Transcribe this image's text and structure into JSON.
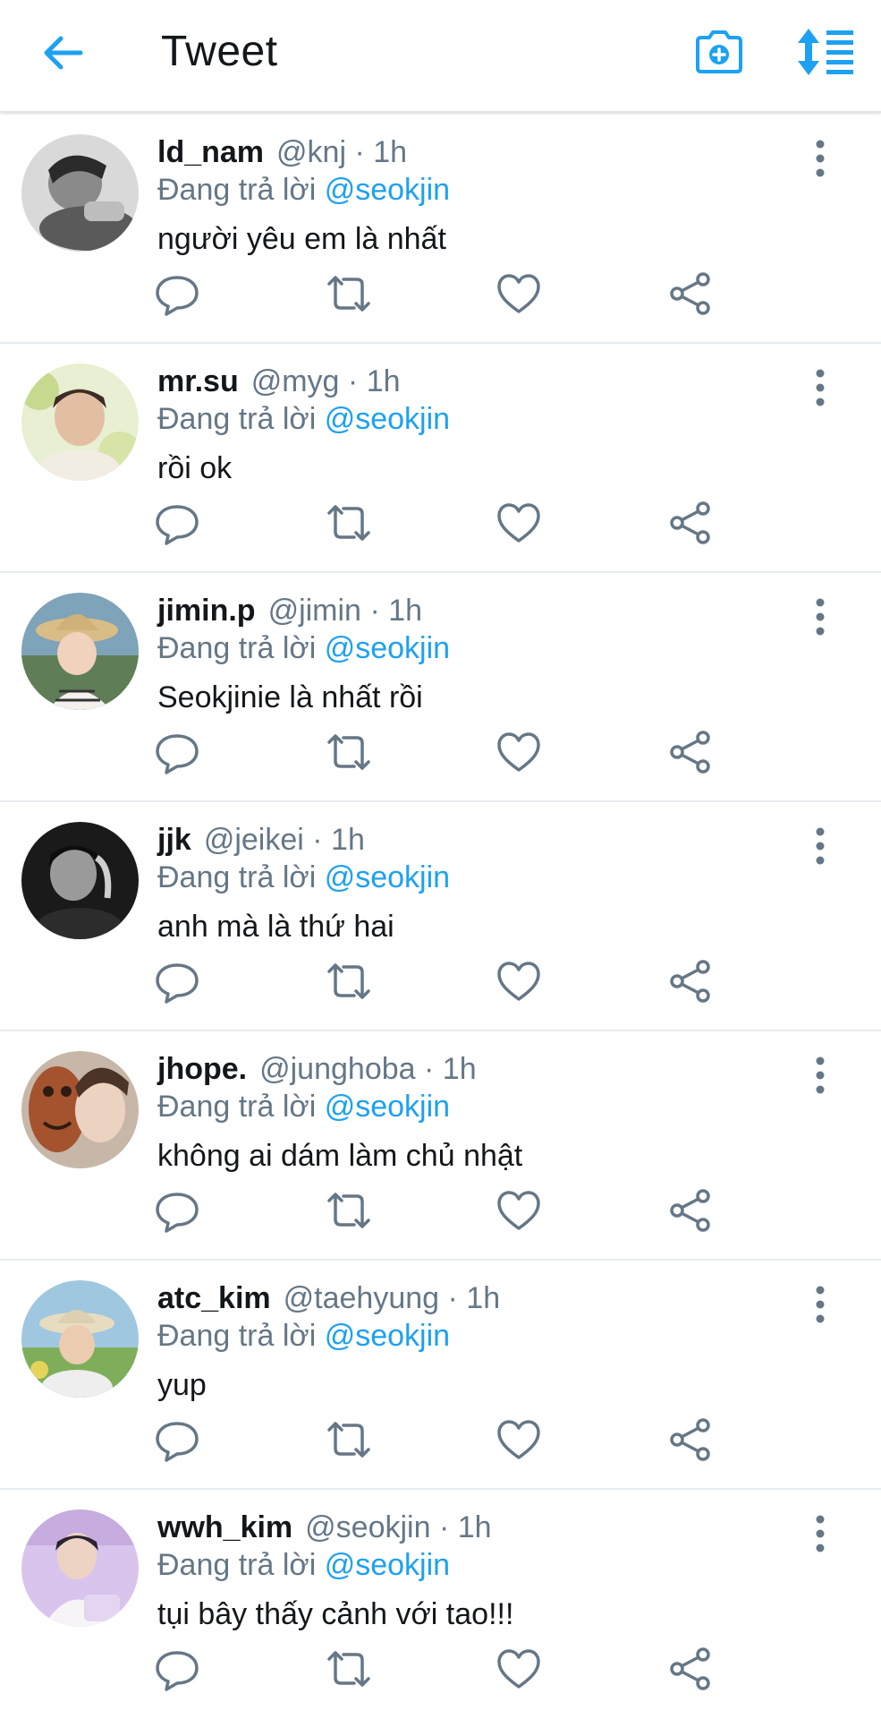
{
  "header": {
    "title": "Tweet",
    "back_icon": "arrow-left-icon",
    "camera_icon": "camera-plus-icon",
    "sort_icon": "sort-list-icon",
    "accent_color": "#1da1f2"
  },
  "tweets": [
    {
      "name": "ld_nam",
      "handle": "@knj",
      "sep": "·",
      "time": "1h",
      "reply_label": "Đang trả lời",
      "reply_to": "@seokjin",
      "text": "người yêu em là nhất"
    },
    {
      "name": "mr.su",
      "handle": "@myg",
      "sep": "·",
      "time": "1h",
      "reply_label": "Đang trả lời",
      "reply_to": "@seokjin",
      "text": "rồi ok"
    },
    {
      "name": "jimin.p",
      "handle": "@jimin",
      "sep": "·",
      "time": "1h",
      "reply_label": "Đang trả lời",
      "reply_to": "@seokjin",
      "text": "Seokjinie là nhất rồi"
    },
    {
      "name": "jjk",
      "handle": "@jeikei",
      "sep": "·",
      "time": "1h",
      "reply_label": "Đang trả lời",
      "reply_to": "@seokjin",
      "text": "anh mà là thứ hai"
    },
    {
      "name": "jhope.",
      "handle": "@junghoba",
      "sep": "·",
      "time": "1h",
      "reply_label": "Đang trả lời",
      "reply_to": "@seokjin",
      "text": "không ai dám làm chủ nhật"
    },
    {
      "name": "atc_kim",
      "handle": "@taehyung",
      "sep": "·",
      "time": "1h",
      "reply_label": "Đang trả lời",
      "reply_to": "@seokjin",
      "text": "yup"
    },
    {
      "name": "wwh_kim",
      "handle": "@seokjin",
      "sep": "·",
      "time": "1h",
      "reply_label": "Đang trả lời",
      "reply_to": "@seokjin",
      "text": "tụi bây thấy cảnh với tao!!!"
    }
  ],
  "action_icons": [
    "reply-icon",
    "retweet-icon",
    "like-icon",
    "share-icon"
  ],
  "colors": {
    "text": "#14171a",
    "muted": "#657786",
    "link": "#1da1f2",
    "divider": "#e6ecf0"
  }
}
